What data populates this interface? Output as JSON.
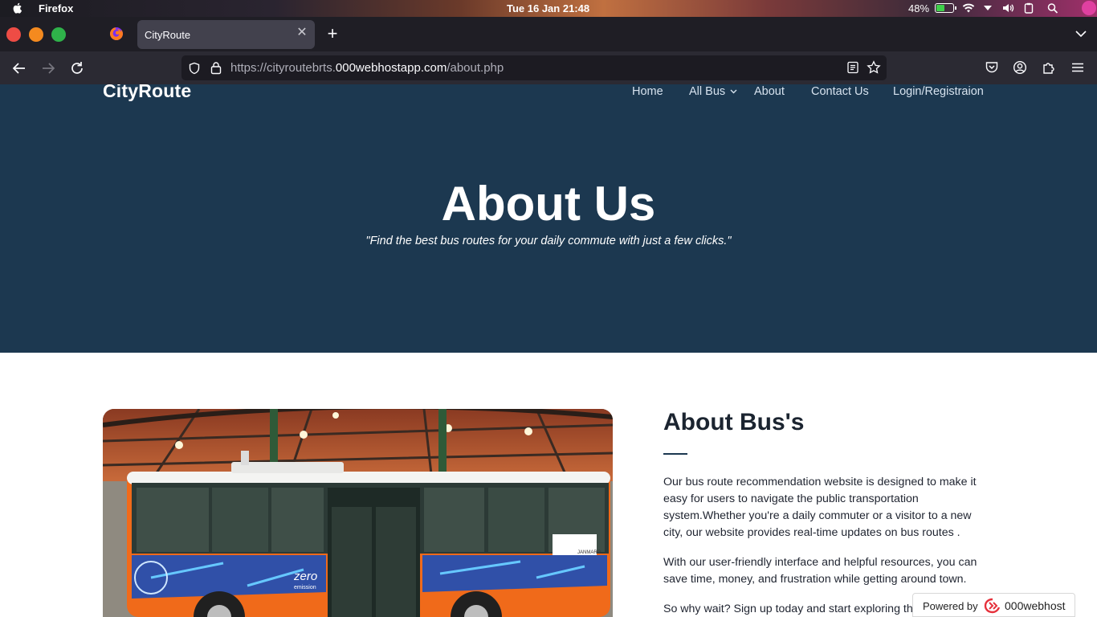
{
  "os_bar": {
    "app_name": "Firefox",
    "clock": "Tue 16 Jan 21:48",
    "battery_percent": "48%",
    "battery_level": 0.48
  },
  "browser": {
    "tab_title": "CityRoute",
    "url_prefix": "https://cityroutebrts.",
    "url_domain": "000webhostapp.com",
    "url_path": "/about.php"
  },
  "site": {
    "brand": "CityRoute",
    "nav": [
      "Home",
      "All Bus",
      "About",
      "Contact Us",
      "Login/Registraion"
    ],
    "hero_title": "About Us",
    "hero_subtitle": "\"Find the best bus routes for your daily commute with just a few clicks.\""
  },
  "about": {
    "heading": "About Bus's",
    "paragraphs": [
      "Our bus route recommendation website is designed to make it easy for users to navigate the public transportation system.Whether you're a daily commuter or a visitor to a new city, our website provides real-time updates on bus routes .",
      "With our user-friendly interface and helpful resources, you can save time, money, and frustration while getting around town.",
      "So why wait? Sign up today and start exploring the best bus routes"
    ],
    "bus_decals": {
      "zero_label": "zero",
      "emission_label": "emission",
      "janmarg_label": "JANMARG"
    }
  },
  "badge": {
    "powered_by": "Powered by",
    "host_name": "000webhost"
  },
  "colors": {
    "hero_bg": "#1c3850",
    "tab_bg": "#42414d",
    "toolbar_bg": "#2b2a33",
    "bus_orange": "#f06a1a",
    "bus_blue": "#3050a8"
  }
}
